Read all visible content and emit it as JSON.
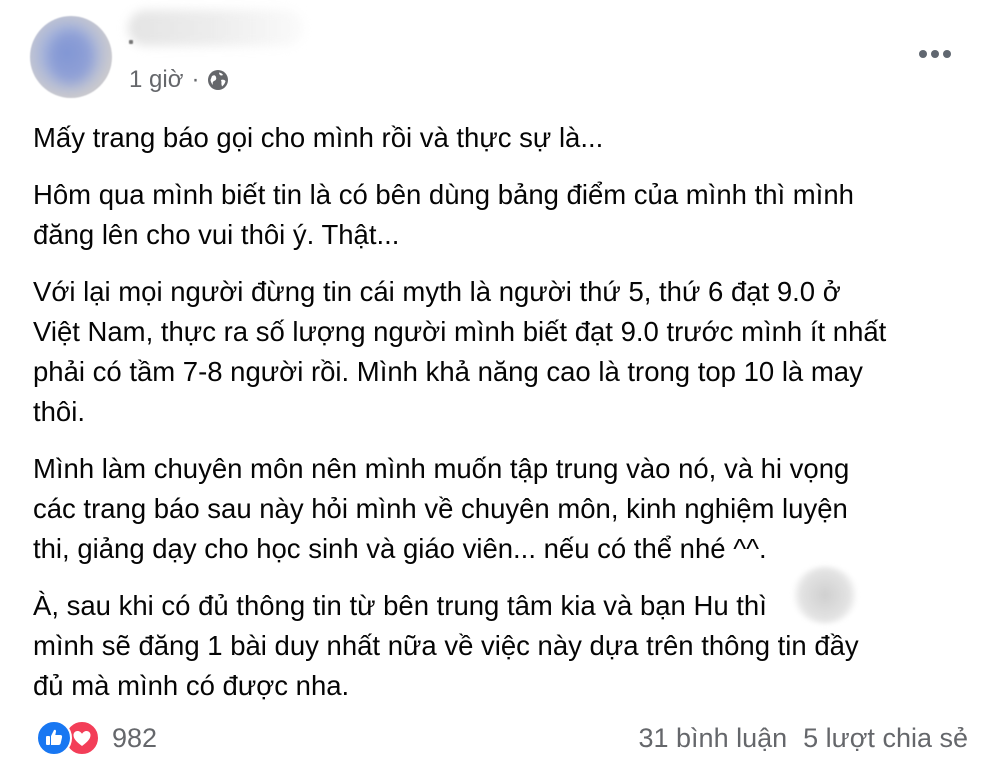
{
  "header": {
    "time": "1 giờ",
    "separator": "·",
    "audience_icon": "globe-icon",
    "more_icon": "more-options-icon"
  },
  "content": {
    "paragraphs": [
      "Mấy trang báo gọi cho mình rồi và thực sự là...",
      "Hôm qua mình biết tin là có bên dùng bảng điểm của mình thì mình\nđăng lên cho vui thôi ý. Thật...",
      "Với lại mọi người đừng tin cái myth là người thứ 5, thứ 6 đạt 9.0 ở\nViệt Nam, thực ra số lượng người mình biết đạt 9.0 trước mình ít nhất\nphải có tầm 7-8 người rồi. Mình khả năng cao là trong top 10 là may\nthôi.",
      "Mình làm chuyên môn nên mình muốn tập trung vào nó, và hi vọng\ncác trang báo sau này hỏi mình về chuyên môn, kinh nghiệm luyện\nthi, giảng dạy cho học sinh và giáo viên... nếu có thể nhé ^^.",
      "À, sau khi có đủ thông tin từ bên trung tâm kia và bạn Hu         thì\nmình sẽ đăng 1 bài duy nhất nữa về việc này dựa trên thông tin đầy\nđủ mà mình có được nha."
    ]
  },
  "footer": {
    "reactions": [
      "like-icon",
      "love-icon"
    ],
    "reaction_count": "982",
    "comments": "31 bình luận",
    "shares": "5 lượt chia sẻ"
  },
  "colors": {
    "text": "#050505",
    "secondary": "#65676b",
    "like": "#1877f2",
    "love": "#f33e58"
  }
}
